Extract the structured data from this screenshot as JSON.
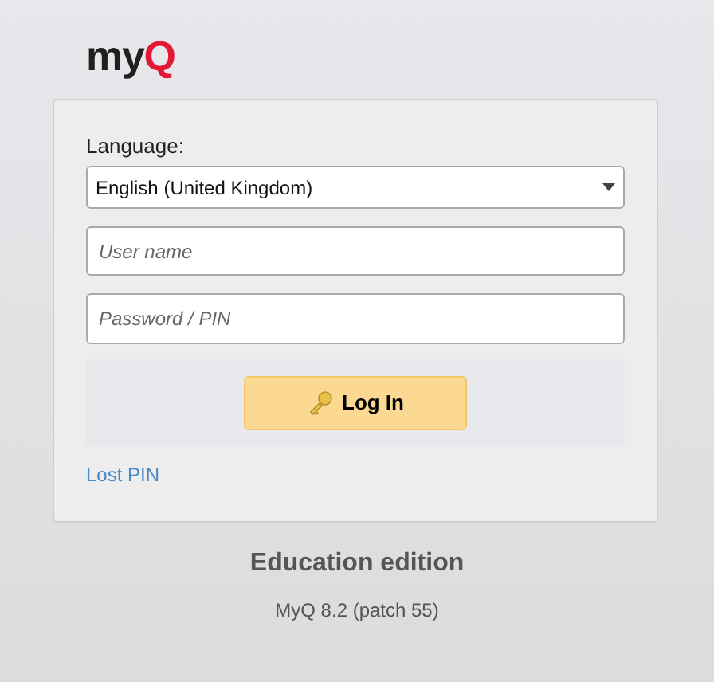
{
  "logo": {
    "main": "my",
    "accent": "Q"
  },
  "form": {
    "language_label": "Language:",
    "language_value": "English (United Kingdom)",
    "username": {
      "placeholder": "User name"
    },
    "password": {
      "placeholder": "Password / PIN"
    },
    "login_button": "Log In",
    "lost_pin_link": "Lost PIN"
  },
  "edition": "Education edition",
  "version": "MyQ 8.2 (patch 55)"
}
